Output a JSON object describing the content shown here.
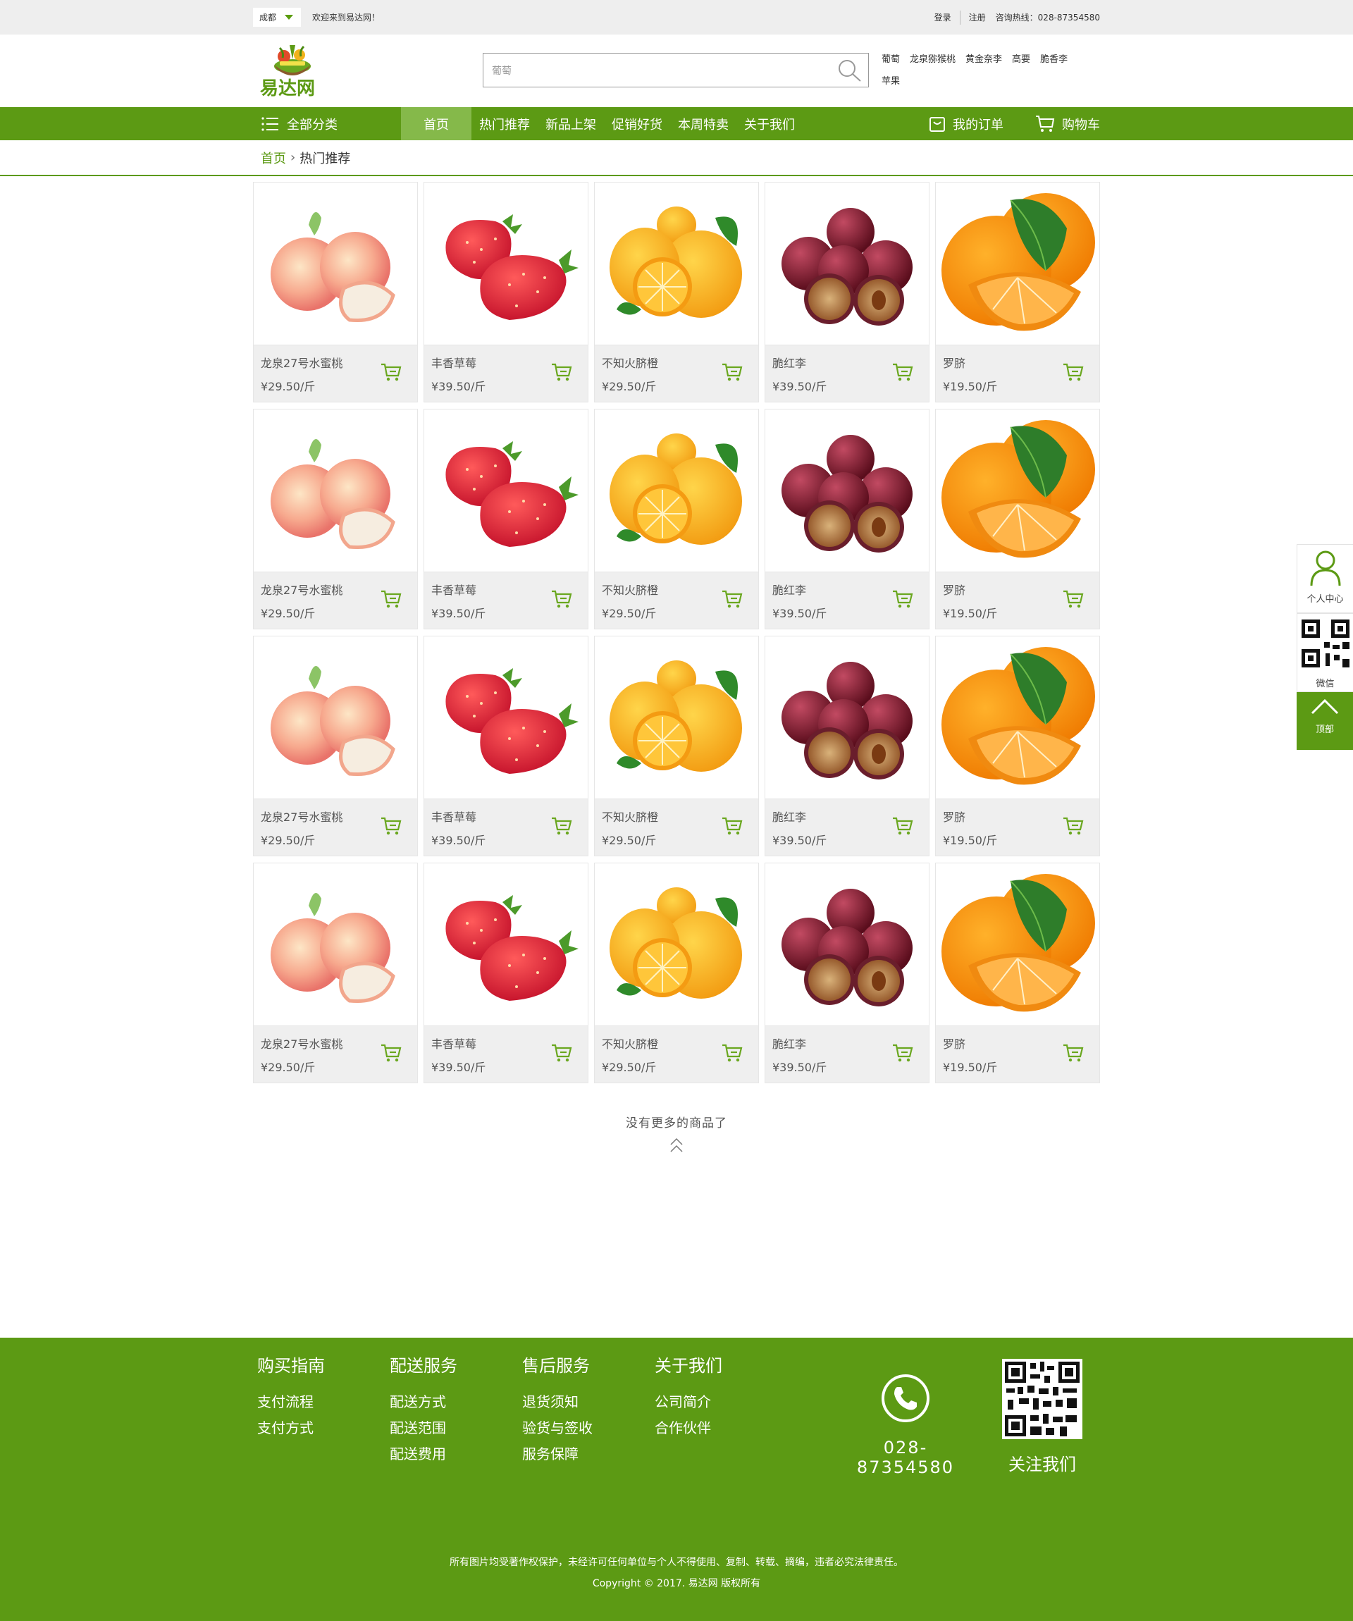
{
  "topbar": {
    "city": "成都",
    "welcome": "欢迎来到易达网！",
    "login": "登录",
    "register": "注册",
    "hotline": "咨询热线：028-87354580"
  },
  "header": {
    "logo_text": "易达网",
    "search_value": "葡萄",
    "hot_words": [
      "葡萄",
      "龙泉猕猴桃",
      "黄金奈李",
      "高要",
      "脆香李",
      "苹果"
    ]
  },
  "nav": {
    "all_categories": "全部分类",
    "items": [
      "首页",
      "热门推荐",
      "新品上架",
      "促销好货",
      "本周特卖",
      "关于我们"
    ],
    "my_orders": "我的订单",
    "cart": "购物车"
  },
  "breadcrumb": {
    "home": "首页",
    "current": "热门推荐"
  },
  "products": [
    {
      "name": "龙泉27号水蜜桃",
      "price": "¥29.50/斤",
      "image": "peach-image"
    },
    {
      "name": "丰香草莓",
      "price": "¥39.50/斤",
      "image": "strawberry-image"
    },
    {
      "name": "不知火脐橙",
      "price": "¥29.50/斤",
      "image": "dekopon-image"
    },
    {
      "name": "脆红李",
      "price": "¥39.50/斤",
      "image": "plum-image"
    },
    {
      "name": "罗脐",
      "price": "¥19.50/斤",
      "image": "orange-image"
    }
  ],
  "end_message": "没有更多的商品了",
  "side": {
    "personal": "个人中心",
    "wechat": "微信",
    "top": "顶部"
  },
  "footer": {
    "columns": [
      {
        "title": "购买指南",
        "links": [
          "支付流程",
          "支付方式"
        ]
      },
      {
        "title": "配送服务",
        "links": [
          "配送方式",
          "配送范围",
          "配送费用"
        ]
      },
      {
        "title": "售后服务",
        "links": [
          "退货须知",
          "验货与签收",
          "服务保障"
        ]
      },
      {
        "title": "关于我们",
        "links": [
          "公司简介",
          "合作伙伴"
        ]
      }
    ],
    "phone": "028-87354580",
    "follow": "关注我们",
    "copyright1": "所有图片均受著作权保护，未经许可任何单位与个人不得使用、复制、转载、摘编，违者必究法律责任。",
    "copyright2": "Copyright © 2017. 易达网 版权所有"
  },
  "colors": {
    "brand_green": "#5c9a14",
    "nav_active": "#85b94a"
  }
}
